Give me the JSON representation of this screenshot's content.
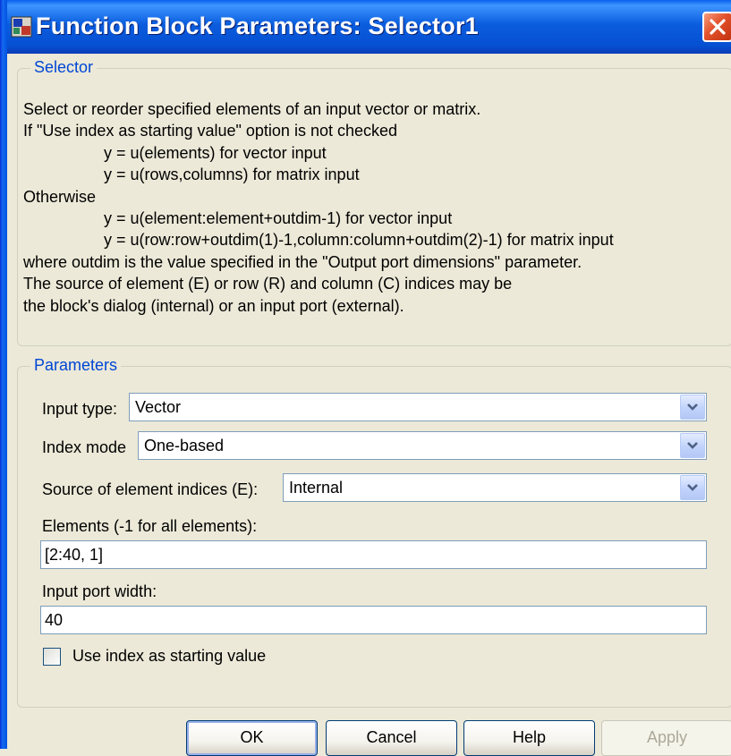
{
  "window": {
    "title": "Function Block Parameters: Selector1"
  },
  "selector_group": {
    "legend": "Selector",
    "lines": [
      "Select or reorder specified elements of an input vector or matrix.",
      "If \"Use index as starting value\" option is not checked",
      "y = u(elements) for vector input",
      "y = u(rows,columns) for matrix input",
      "Otherwise",
      "y = u(element:element+outdim-1) for vector input",
      "y = u(row:row+outdim(1)-1,column:column+outdim(2)-1) for matrix input",
      "where outdim is the value specified in the \"Output port dimensions\" parameter.",
      "The source of element (E) or row (R) and column (C) indices may be",
      "the block's dialog (internal) or an input port (external)."
    ]
  },
  "parameters_group": {
    "legend": "Parameters",
    "input_type": {
      "label": "Input type:",
      "value": "Vector"
    },
    "index_mode": {
      "label": "Index mode",
      "value": "One-based"
    },
    "source_indices": {
      "label": "Source of element indices (E):",
      "value": "Internal"
    },
    "elements": {
      "label": "Elements (-1 for all elements):",
      "value": "[2:40, 1]"
    },
    "input_port_width": {
      "label": "Input port width:",
      "value": "40"
    },
    "use_index_checkbox": {
      "label": "Use index as starting value",
      "checked": false
    }
  },
  "buttons": {
    "ok": "OK",
    "cancel": "Cancel",
    "help": "Help",
    "apply": "Apply"
  },
  "colors": {
    "legend": "#0046D5",
    "titlebar": "#0A5FEE",
    "face": "#ECE9D8"
  },
  "icons": {
    "title": "simulink-block-icon",
    "close": "close-icon",
    "dropdown": "chevron-down-icon"
  }
}
